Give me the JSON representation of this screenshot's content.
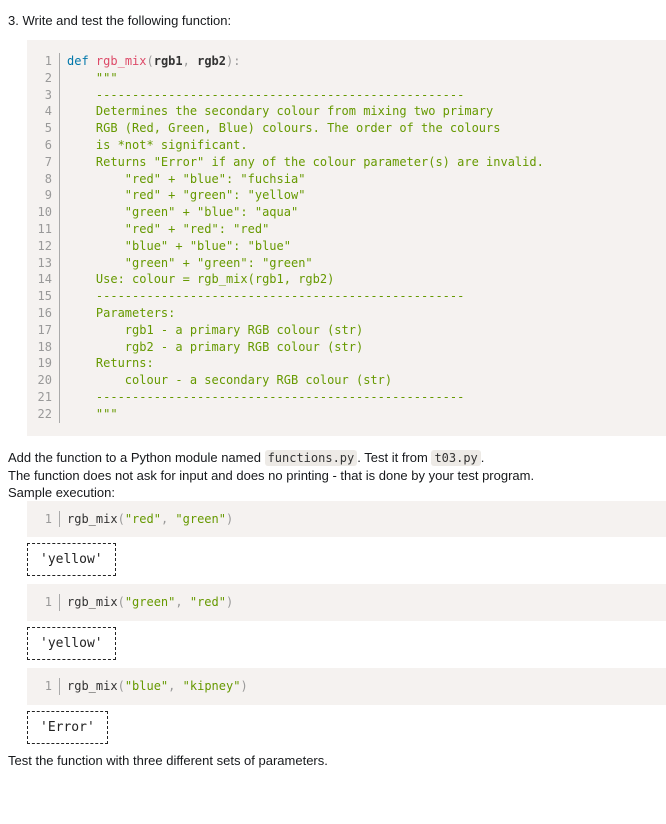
{
  "page": {
    "heading": "3. Write and test the following function:",
    "para_add": {
      "text1": "Add the function to a Python module named ",
      "code1": "functions.py",
      "text2": ". Test it from ",
      "code2": "t03.py",
      "text3": "."
    },
    "para_noinput": "The function does not ask for input and does no printing - that is done by your test program.",
    "para_sample": "Sample execution:",
    "para_test": "Test the function with three different sets of parameters."
  },
  "colors": {
    "code_background": "#f5f2f0",
    "keyword": "#0077aa",
    "function_name": "#dd4a68",
    "string": "#669900",
    "punctuation": "#999999",
    "line_number": "#999999",
    "plain_code": "#333333"
  },
  "code_blocks": {
    "main": {
      "lines": [
        {
          "num": "1",
          "tokens": [
            [
              "kw",
              "def"
            ],
            [
              "pln",
              " "
            ],
            [
              "fn",
              "rgb_mix"
            ],
            [
              "pun",
              "("
            ],
            [
              "arg",
              "rgb1"
            ],
            [
              "pun",
              ","
            ],
            [
              "pln",
              " "
            ],
            [
              "arg",
              "rgb2"
            ],
            [
              "pun",
              "):"
            ]
          ]
        },
        {
          "num": "2",
          "tokens": [
            [
              "str",
              "    \"\"\""
            ]
          ]
        },
        {
          "num": "3",
          "tokens": [
            [
              "str",
              "    ---------------------------------------------------"
            ]
          ]
        },
        {
          "num": "4",
          "tokens": [
            [
              "str",
              "    Determines the secondary colour from mixing two primary"
            ]
          ]
        },
        {
          "num": "5",
          "tokens": [
            [
              "str",
              "    RGB (Red, Green, Blue) colours. The order of the colours"
            ]
          ]
        },
        {
          "num": "6",
          "tokens": [
            [
              "str",
              "    is *not* significant."
            ]
          ]
        },
        {
          "num": "7",
          "tokens": [
            [
              "str",
              "    Returns \"Error\" if any of the colour parameter(s) are invalid."
            ]
          ]
        },
        {
          "num": "8",
          "tokens": [
            [
              "str",
              "        \"red\" + \"blue\": \"fuchsia\""
            ]
          ]
        },
        {
          "num": "9",
          "tokens": [
            [
              "str",
              "        \"red\" + \"green\": \"yellow\""
            ]
          ]
        },
        {
          "num": "10",
          "tokens": [
            [
              "str",
              "        \"green\" + \"blue\": \"aqua\""
            ]
          ]
        },
        {
          "num": "11",
          "tokens": [
            [
              "str",
              "        \"red\" + \"red\": \"red\""
            ]
          ]
        },
        {
          "num": "12",
          "tokens": [
            [
              "str",
              "        \"blue\" + \"blue\": \"blue\""
            ]
          ]
        },
        {
          "num": "13",
          "tokens": [
            [
              "str",
              "        \"green\" + \"green\": \"green\""
            ]
          ]
        },
        {
          "num": "14",
          "tokens": [
            [
              "str",
              "    Use: colour = rgb_mix(rgb1, rgb2)"
            ]
          ]
        },
        {
          "num": "15",
          "tokens": [
            [
              "str",
              "    ---------------------------------------------------"
            ]
          ]
        },
        {
          "num": "16",
          "tokens": [
            [
              "str",
              "    Parameters:"
            ]
          ]
        },
        {
          "num": "17",
          "tokens": [
            [
              "str",
              "        rgb1 - a primary RGB colour (str)"
            ]
          ]
        },
        {
          "num": "18",
          "tokens": [
            [
              "str",
              "        rgb2 - a primary RGB colour (str)"
            ]
          ]
        },
        {
          "num": "19",
          "tokens": [
            [
              "str",
              "    Returns:"
            ]
          ]
        },
        {
          "num": "20",
          "tokens": [
            [
              "str",
              "        colour - a secondary RGB colour (str)"
            ]
          ]
        },
        {
          "num": "21",
          "tokens": [
            [
              "str",
              "    ---------------------------------------------------"
            ]
          ]
        },
        {
          "num": "22",
          "tokens": [
            [
              "str",
              "    \"\"\""
            ]
          ]
        }
      ]
    },
    "sample1": {
      "lines": [
        {
          "num": "1",
          "tokens": [
            [
              "pln",
              "rgb_mix"
            ],
            [
              "pun",
              "("
            ],
            [
              "str",
              "\"red\""
            ],
            [
              "pun",
              ","
            ],
            [
              "pln",
              " "
            ],
            [
              "str",
              "\"green\""
            ],
            [
              "pun",
              ")"
            ]
          ]
        }
      ]
    },
    "sample2": {
      "lines": [
        {
          "num": "1",
          "tokens": [
            [
              "pln",
              "rgb_mix"
            ],
            [
              "pun",
              "("
            ],
            [
              "str",
              "\"green\""
            ],
            [
              "pun",
              ","
            ],
            [
              "pln",
              " "
            ],
            [
              "str",
              "\"red\""
            ],
            [
              "pun",
              ")"
            ]
          ]
        }
      ]
    },
    "sample3": {
      "lines": [
        {
          "num": "1",
          "tokens": [
            [
              "pln",
              "rgb_mix"
            ],
            [
              "pun",
              "("
            ],
            [
              "str",
              "\"blue\""
            ],
            [
              "pun",
              ","
            ],
            [
              "pln",
              " "
            ],
            [
              "str",
              "\"kipney\""
            ],
            [
              "pun",
              ")"
            ]
          ]
        }
      ]
    }
  },
  "outputs": {
    "out1": "'yellow'",
    "out2": "'yellow'",
    "out3": "'Error'"
  }
}
